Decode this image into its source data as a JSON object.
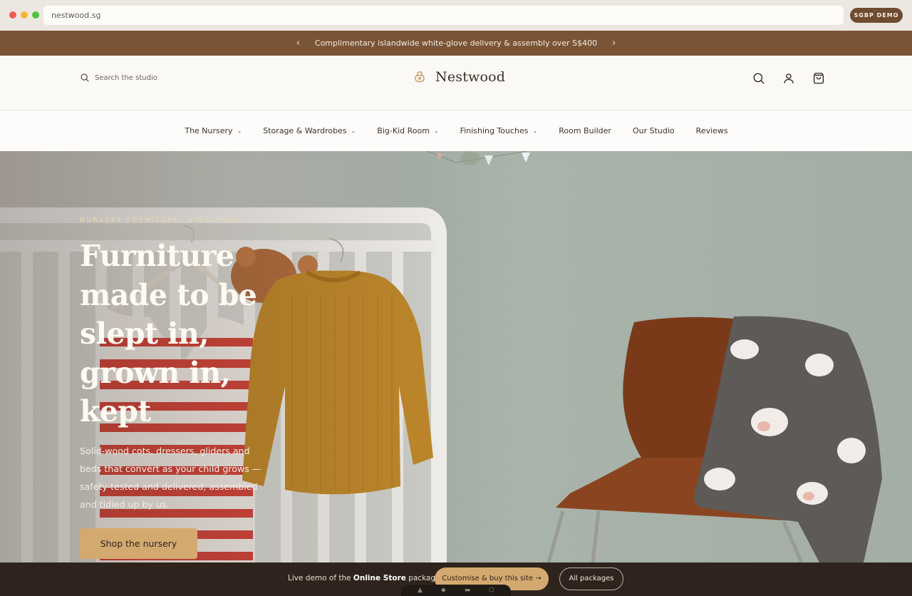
{
  "browser": {
    "url": "nestwood.sg",
    "badge": "SGBP DEMO"
  },
  "announcement": {
    "prev": "‹",
    "text": "Complimentary islandwide white-glove delivery & assembly over S$400",
    "next": "›"
  },
  "header": {
    "search_placeholder": "Search the studio",
    "brand": "Nestwood",
    "icons": [
      "search-icon",
      "account-icon",
      "cart-icon"
    ]
  },
  "nav": {
    "items": [
      {
        "label": "The Nursery",
        "dropdown": true
      },
      {
        "label": "Storage & Wardrobes",
        "dropdown": true
      },
      {
        "label": "Big-Kid Room",
        "dropdown": true
      },
      {
        "label": "Finishing Touches",
        "dropdown": true
      },
      {
        "label": "Room Builder",
        "dropdown": false
      },
      {
        "label": "Our Studio",
        "dropdown": false
      },
      {
        "label": "Reviews",
        "dropdown": false
      }
    ],
    "chevron": "⌄"
  },
  "hero": {
    "eyebrow": "NURSERY FURNITURE, SINGAPORE",
    "headline": "Furniture made to be slept in, grown in, kept",
    "subtext": "Solid-wood cots, dressers, gliders and beds that convert as your child grows — safety-tested and delivered, assembled and tidied up by us.",
    "cta": "Shop the nursery"
  },
  "bottom_bar": {
    "text_prefix": "Live demo of the ",
    "text_bold": "Online Store",
    "text_suffix": " package.",
    "primary": "Customise & buy this site →",
    "secondary": "All packages"
  },
  "colors": {
    "announcement_bg": "#7a5437",
    "accent": "#d4a96f",
    "bottom_bar_bg": "#2e241d"
  }
}
